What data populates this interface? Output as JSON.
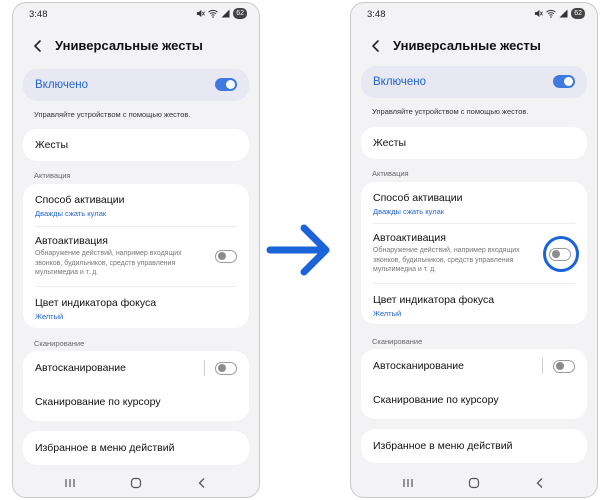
{
  "status": {
    "time": "3:48",
    "battery": "62"
  },
  "page_title": "Универсальные жесты",
  "master_toggle": {
    "label": "Включено",
    "state": "on"
  },
  "description": "Управляйте устройством с помощью жестов.",
  "gestures_item": "Жесты",
  "section_activation": "Активация",
  "activation_method": {
    "title": "Способ активации",
    "value": "Дважды сжать кулак"
  },
  "auto_activation": {
    "title": "Автоактивация",
    "desc": "Обнаружение действий, например входящих звонков, будильников, средств управления мультимедиа и т. д.",
    "state": "off"
  },
  "focus_color": {
    "title": "Цвет индикатора фокуса",
    "value": "Желтый"
  },
  "section_scanning": "Сканирование",
  "auto_scanning": {
    "title": "Автосканирование",
    "state": "off"
  },
  "cursor_scanning": "Сканирование по курсору",
  "favorites_item": "Избранное в меню действий",
  "navbar_icons": [
    "recent-apps-icon",
    "home-icon",
    "back-icon"
  ],
  "colors": {
    "accent": "#1f63d6",
    "toggle_on": "#3e7be0",
    "highlight": "#1a63d9",
    "arrow": "#1a63d9",
    "screen_bg": "#f3f3f6"
  }
}
